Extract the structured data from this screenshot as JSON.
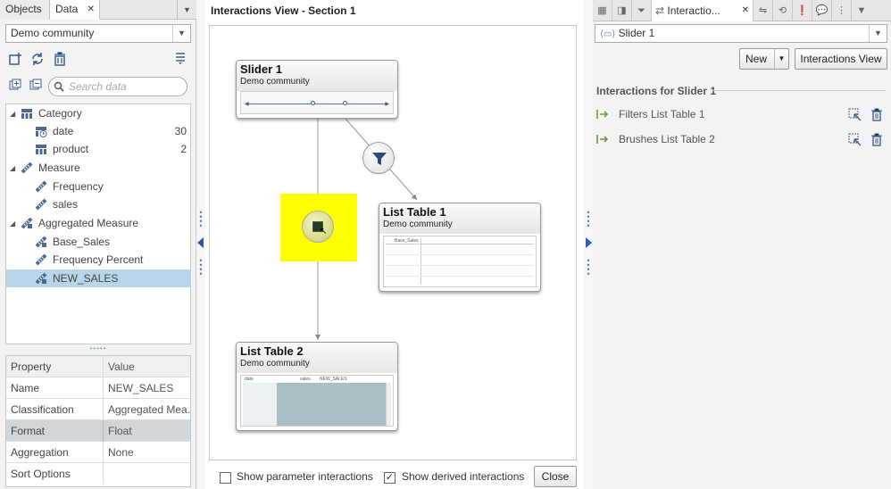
{
  "left": {
    "tabs": {
      "objects": "Objects",
      "data": "Data",
      "close": "✕"
    },
    "datasource": "Demo community",
    "search_placeholder": "Search data",
    "tree": [
      {
        "label": "Category",
        "level": 0,
        "icon": "category-icon",
        "count": ""
      },
      {
        "label": "date",
        "level": 1,
        "icon": "date-icon",
        "count": "30"
      },
      {
        "label": "product",
        "level": 1,
        "icon": "category-icon",
        "count": "2"
      },
      {
        "label": "Measure",
        "level": 0,
        "icon": "measure-icon",
        "count": ""
      },
      {
        "label": "Frequency",
        "level": 1,
        "icon": "measure-icon",
        "count": ""
      },
      {
        "label": "sales",
        "level": 1,
        "icon": "measure-icon",
        "count": ""
      },
      {
        "label": "Aggregated Measure",
        "level": 0,
        "icon": "aggregated-measure-icon",
        "count": ""
      },
      {
        "label": "Base_Sales",
        "level": 1,
        "icon": "aggregated-measure-icon",
        "count": ""
      },
      {
        "label": "Frequency Percent",
        "level": 1,
        "icon": "measure-icon",
        "count": ""
      },
      {
        "label": "NEW_SALES",
        "level": 1,
        "icon": "aggregated-measure-icon",
        "count": ""
      }
    ],
    "properties": {
      "header": {
        "property": "Property",
        "value": "Value"
      },
      "rows": [
        {
          "property": "Name",
          "value": "NEW_SALES"
        },
        {
          "property": "Classification",
          "value": "Aggregated Mea..."
        },
        {
          "property": "Format",
          "value": "Float"
        },
        {
          "property": "Aggregation",
          "value": "None"
        },
        {
          "property": "Sort Options",
          "value": ""
        }
      ]
    }
  },
  "center": {
    "title": "Interactions View - Section 1",
    "nodes": {
      "slider": {
        "title": "Slider 1",
        "subtitle": "Demo community"
      },
      "list1": {
        "title": "List Table 1",
        "subtitle": "Demo community",
        "col": "Base_Sales"
      },
      "list2": {
        "title": "List Table 2",
        "subtitle": "Demo community",
        "cols": [
          "date",
          "sales",
          "NEW_SALES"
        ]
      }
    },
    "show_parameter": "Show parameter interactions",
    "show_derived": "Show derived interactions",
    "close": "Close"
  },
  "right": {
    "tab_label": "Interactio...",
    "selected_object": "Slider 1",
    "new_button": "New",
    "view_button": "Interactions View",
    "section_title": "Interactions for Slider 1",
    "interactions": [
      {
        "label": "Filters List Table 1"
      },
      {
        "label": "Brushes List Table 2"
      }
    ]
  },
  "colors": {
    "selection": "#b7d6ea",
    "highlight": "#ffff00",
    "accent": "#5a7aa8"
  }
}
